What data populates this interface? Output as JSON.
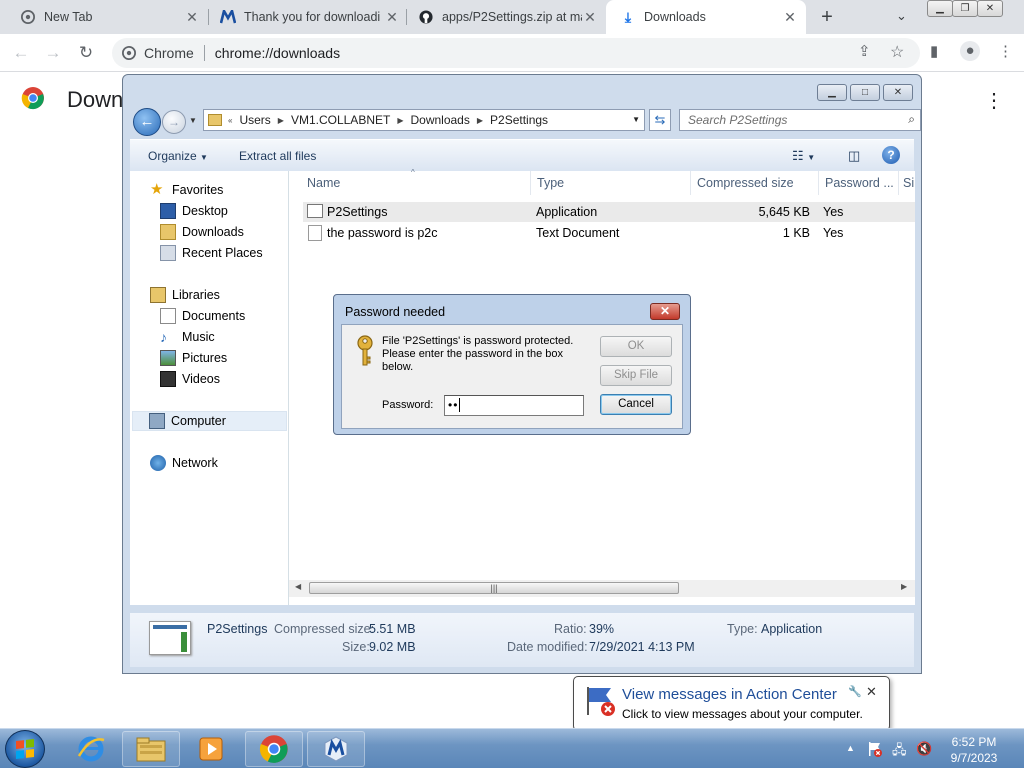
{
  "browser": {
    "tabs": [
      {
        "title": "New Tab",
        "icon": "chrome-icon",
        "active": false
      },
      {
        "title": "Thank you for downloadi",
        "icon": "m-logo-icon",
        "active": false
      },
      {
        "title": "apps/P2Settings.zip at ma",
        "icon": "github-icon",
        "active": false
      },
      {
        "title": "Downloads",
        "icon": "download-icon",
        "active": true
      }
    ],
    "omnibox": {
      "chip": "Chrome",
      "url": "chrome://downloads"
    },
    "page_title": "Down"
  },
  "explorer": {
    "breadcrumb": [
      "Users",
      "VM1.COLLABNET",
      "Downloads",
      "P2Settings"
    ],
    "search_placeholder": "Search P2Settings",
    "commands": {
      "organize": "Organize",
      "extract": "Extract all files"
    },
    "nav": {
      "favorites": "Favorites",
      "desktop": "Desktop",
      "downloads": "Downloads",
      "recent": "Recent Places",
      "libraries": "Libraries",
      "documents": "Documents",
      "music": "Music",
      "pictures": "Pictures",
      "videos": "Videos",
      "computer": "Computer",
      "network": "Network"
    },
    "columns": [
      "Name",
      "Type",
      "Compressed size",
      "Password ...",
      "Si"
    ],
    "files": [
      {
        "name": "P2Settings",
        "type": "Application",
        "size": "5,645 KB",
        "password": "Yes"
      },
      {
        "name": "the password is p2c",
        "type": "Text Document",
        "size": "1 KB",
        "password": "Yes"
      }
    ],
    "details": {
      "name": "P2Settings",
      "compressed_label": "Compressed size:",
      "compressed_value": "5.51 MB",
      "size_label": "Size:",
      "size_value": "9.02 MB",
      "ratio_label": "Ratio:",
      "ratio_value": "39%",
      "modified_label": "Date modified:",
      "modified_value": "7/29/2021 4:13 PM",
      "type_label": "Type:",
      "type_value": "Application"
    }
  },
  "dialog": {
    "title": "Password needed",
    "message": "File 'P2Settings' is password protected. Please enter the password in the box below.",
    "password_label": "Password:",
    "password_value": "••",
    "buttons": {
      "ok": "OK",
      "skip": "Skip File",
      "cancel": "Cancel"
    }
  },
  "balloon": {
    "title": "View messages in Action Center",
    "text": "Click to view messages about your computer."
  },
  "clock": {
    "time": "6:52 PM",
    "date": "9/7/2023"
  }
}
